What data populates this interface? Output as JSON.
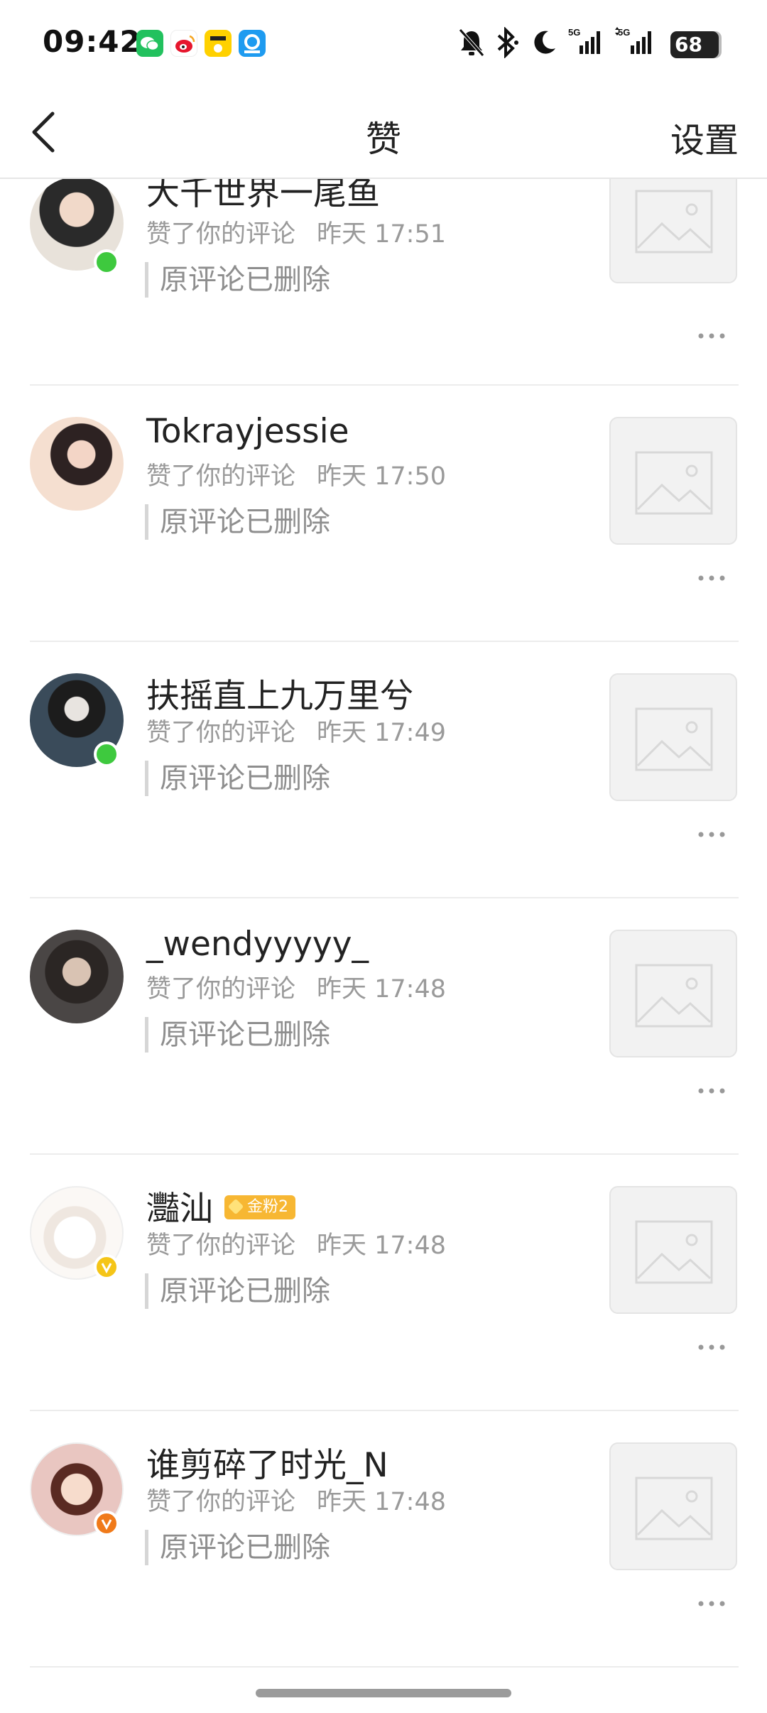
{
  "status_bar": {
    "time": "09:42",
    "apps": [
      {
        "name": "wechat-icon",
        "color": "#22c15e"
      },
      {
        "name": "weibo-icon",
        "color": "#f5a623"
      },
      {
        "name": "meituan-icon",
        "color": "#ffd100"
      },
      {
        "name": "eleme-icon",
        "color": "#1e9bf0"
      }
    ],
    "right_icons": [
      "mute-icon",
      "bluetooth-icon",
      "moon-icon",
      "signal-5g-icon",
      "signal-5g-icon-2"
    ],
    "network_label_1": "5G",
    "network_label_2": "5G",
    "battery": "68"
  },
  "nav": {
    "title": "赞",
    "settings_label": "设置"
  },
  "items": [
    {
      "username": "大千世界一尾鱼",
      "action": "赞了你的评论",
      "time": "昨天 17:51",
      "quote": "原评论已删除",
      "badge": "online",
      "badge_color": "#3ec93e",
      "fan_badge": ""
    },
    {
      "username": "Tokrayjessie",
      "action": "赞了你的评论",
      "time": "昨天 17:50",
      "quote": "原评论已删除",
      "badge": "",
      "badge_color": "",
      "fan_badge": ""
    },
    {
      "username": "扶摇直上九万里兮",
      "action": "赞了你的评论",
      "time": "昨天 17:49",
      "quote": "原评论已删除",
      "badge": "online",
      "badge_color": "#3ec93e",
      "fan_badge": ""
    },
    {
      "username": "_wendyyyyy_",
      "action": "赞了你的评论",
      "time": "昨天 17:48",
      "quote": "原评论已删除",
      "badge": "",
      "badge_color": "",
      "fan_badge": ""
    },
    {
      "username": "灩汕",
      "action": "赞了你的评论",
      "time": "昨天 17:48",
      "quote": "原评论已删除",
      "badge": "verified",
      "badge_color": "#f5c518",
      "fan_badge": "金粉2"
    },
    {
      "username": "谁剪碎了时光_N",
      "action": "赞了你的评论",
      "time": "昨天 17:48",
      "quote": "原评论已删除",
      "badge": "verified",
      "badge_color": "#f07a1a",
      "fan_badge": ""
    }
  ],
  "colors": {
    "accent_fan": "#f7b733",
    "online": "#3ec93e"
  }
}
